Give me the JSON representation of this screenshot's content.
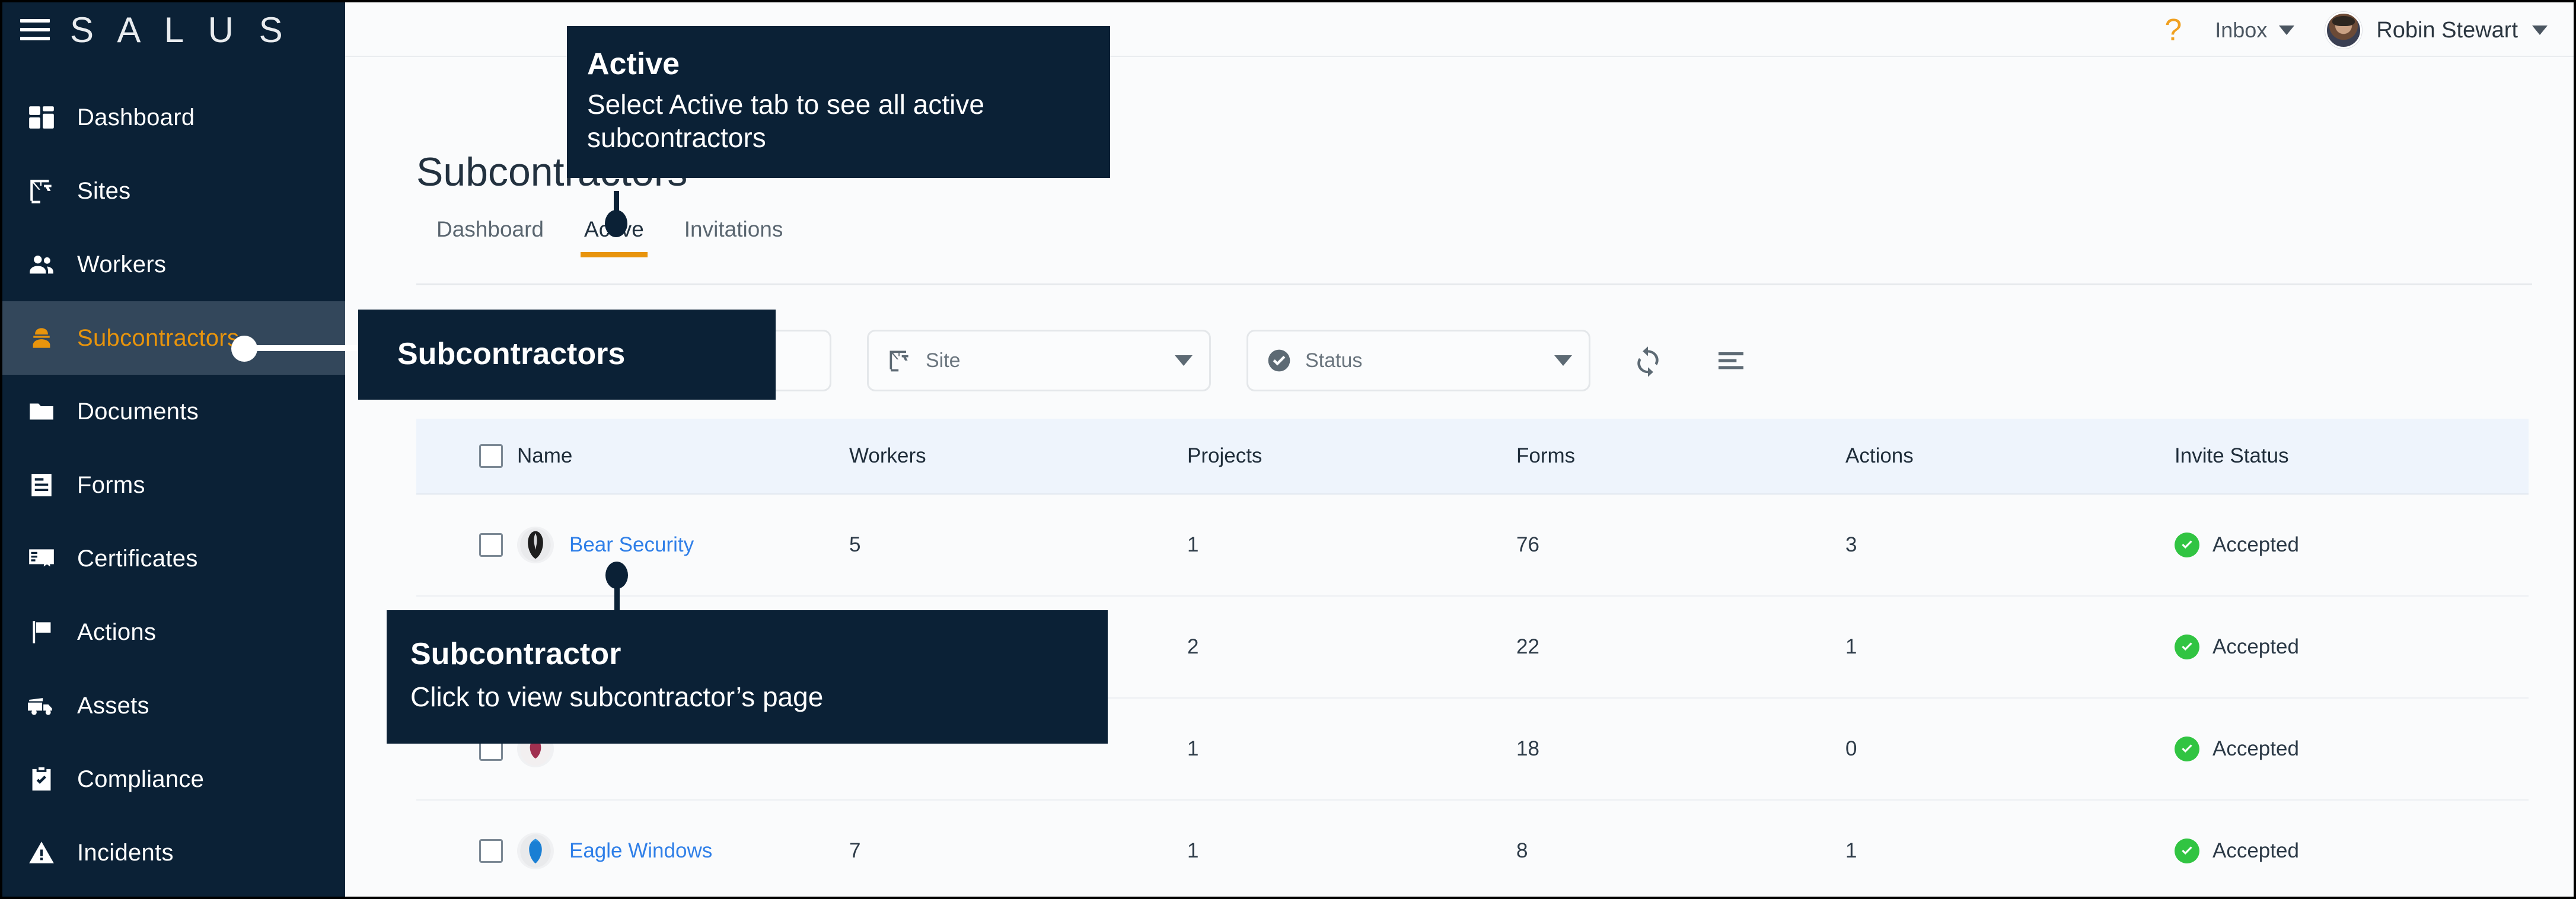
{
  "brand": {
    "name": "S A L U S",
    "menu_icon": "hamburger-menu-icon"
  },
  "sidebar": {
    "items": [
      {
        "label": "Dashboard",
        "icon": "dashboard-icon",
        "active": false
      },
      {
        "label": "Sites",
        "icon": "crane-icon",
        "active": false
      },
      {
        "label": "Workers",
        "icon": "people-icon",
        "active": false
      },
      {
        "label": "Subcontractors",
        "icon": "hardhat-worker-icon",
        "active": true
      },
      {
        "label": "Documents",
        "icon": "folder-icon",
        "active": false
      },
      {
        "label": "Forms",
        "icon": "form-icon",
        "active": false
      },
      {
        "label": "Certificates",
        "icon": "certificate-icon",
        "active": false
      },
      {
        "label": "Actions",
        "icon": "flag-icon",
        "active": false
      },
      {
        "label": "Assets",
        "icon": "truck-icon",
        "active": false
      },
      {
        "label": "Compliance",
        "icon": "clipboard-check-icon",
        "active": false
      },
      {
        "label": "Incidents",
        "icon": "warning-triangle-icon",
        "active": false
      }
    ],
    "active_bg": "#33475b",
    "accent": "#e8940c",
    "bg": "#0b2136"
  },
  "header": {
    "help_icon": "question-mark-help-icon",
    "inbox_label": "Inbox",
    "user_name": "Robin Stewart",
    "avatar_icon": "user-avatar"
  },
  "page": {
    "title": "Subcontractors",
    "tabs": [
      {
        "label": "Dashboard",
        "selected": false
      },
      {
        "label": "Active",
        "selected": true
      },
      {
        "label": "Invitations",
        "selected": false
      }
    ]
  },
  "filters": {
    "search_value": "",
    "search_placeholder": "",
    "site": {
      "label": "Site",
      "icon": "crane-icon"
    },
    "status": {
      "label": "Status",
      "icon": "check-circle-icon"
    },
    "refresh_icon": "refresh-icon",
    "sort_icon": "sort-filter-icon"
  },
  "table": {
    "columns": [
      "Name",
      "Workers",
      "Projects",
      "Forms",
      "Actions",
      "Invite Status"
    ],
    "rows": [
      {
        "name": "Bear Security",
        "workers": "5",
        "projects": "1",
        "forms": "76",
        "actions": "3",
        "invite_status": "Accepted",
        "logo": "bear-logo",
        "logo_color": "#2b2b2b",
        "hidden_name": false
      },
      {
        "name": "",
        "workers": "",
        "projects": "2",
        "forms": "22",
        "actions": "1",
        "invite_status": "Accepted",
        "logo": "company-logo",
        "logo_color": "#8a8f96",
        "hidden_name": true
      },
      {
        "name": "",
        "workers": "",
        "projects": "1",
        "forms": "18",
        "actions": "0",
        "invite_status": "Accepted",
        "logo": "coyote-logo",
        "logo_color": "#a03050",
        "hidden_name": true
      },
      {
        "name": "Eagle Windows",
        "workers": "7",
        "projects": "1",
        "forms": "8",
        "actions": "1",
        "invite_status": "Accepted",
        "logo": "eagle-logo",
        "logo_color": "#1a7fd4",
        "hidden_name": false
      }
    ],
    "status_color": "#31c442",
    "header_bg": "#eef4fc"
  },
  "callouts": {
    "active_tab": {
      "title": "Active",
      "body": "Select Active tab to see all active subcontractors"
    },
    "sidebar_label": {
      "title": "Subcontractors"
    },
    "subcontractor_link": {
      "title": "Subcontractor",
      "body": "Click to view subcontractor’s page"
    }
  }
}
